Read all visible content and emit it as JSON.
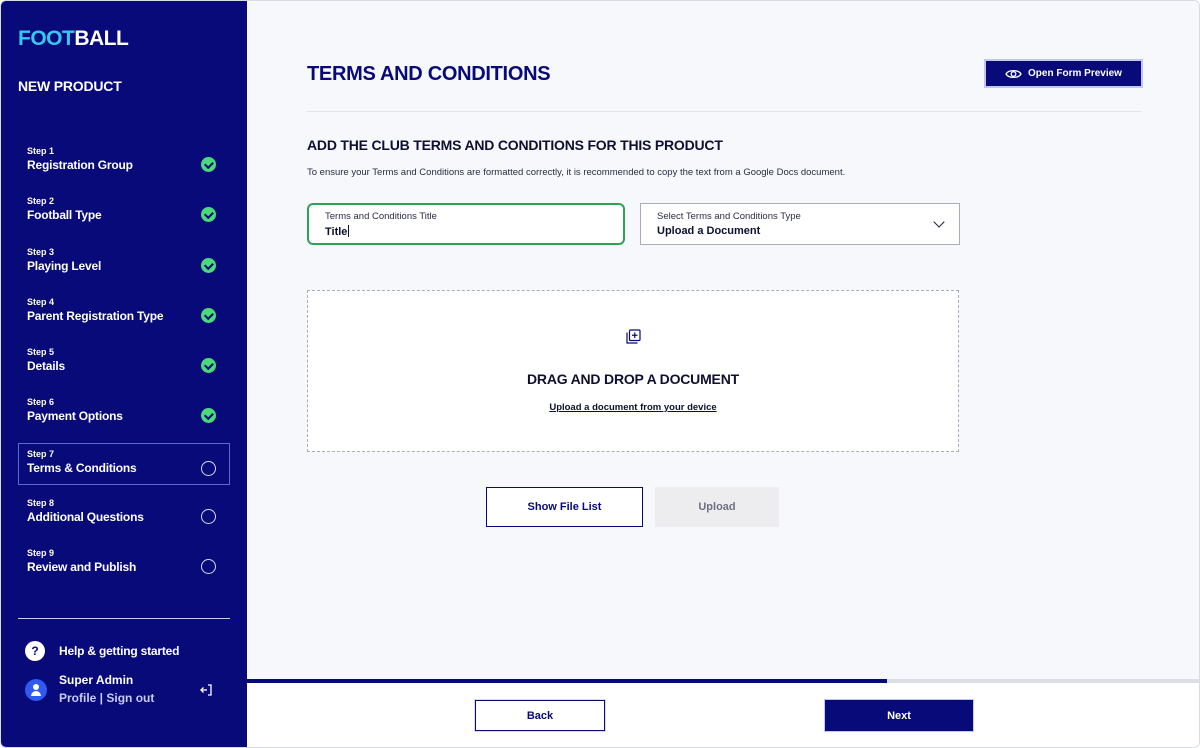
{
  "brand": {
    "logo_accent": "FOOT",
    "logo_rest": "BALL",
    "accent_color": "#35c7f0",
    "primary_color": "#070a78"
  },
  "sidebar": {
    "product_title": "NEW PRODUCT",
    "steps": [
      {
        "num": "Step 1",
        "label": "Registration Group",
        "status": "complete"
      },
      {
        "num": "Step 2",
        "label": "Football Type",
        "status": "complete"
      },
      {
        "num": "Step 3",
        "label": "Playing Level",
        "status": "complete"
      },
      {
        "num": "Step 4",
        "label": "Parent Registration Type",
        "status": "complete"
      },
      {
        "num": "Step 5",
        "label": "Details",
        "status": "complete"
      },
      {
        "num": "Step 6",
        "label": "Payment Options",
        "status": "complete"
      },
      {
        "num": "Step 7",
        "label": "Terms & Conditions",
        "status": "current"
      },
      {
        "num": "Step 8",
        "label": "Additional Questions",
        "status": "incomplete"
      },
      {
        "num": "Step 9",
        "label": "Review and Publish",
        "status": "incomplete"
      }
    ],
    "help_label": "Help & getting started",
    "user_name": "Super Admin",
    "user_links": "Profile | Sign out"
  },
  "main": {
    "title": "TERMS AND CONDITIONS",
    "preview_button": "Open Form Preview",
    "section_title": "ADD THE CLUB TERMS AND CONDITIONS FOR THIS PRODUCT",
    "section_desc": "To ensure your Terms and Conditions are formatted correctly, it is recommended to copy the text from a Google Docs document.",
    "title_field": {
      "label": "Terms and Conditions Title",
      "value": "Title"
    },
    "type_field": {
      "label": "Select Terms and Conditions Type",
      "value": "Upload a Document"
    },
    "dropzone": {
      "title": "DRAG AND DROP A DOCUMENT",
      "link": "Upload a document from your device"
    },
    "show_file_list": "Show File List",
    "upload": "Upload"
  },
  "footer": {
    "progress": 0.671,
    "back": "Back",
    "next": "Next"
  }
}
